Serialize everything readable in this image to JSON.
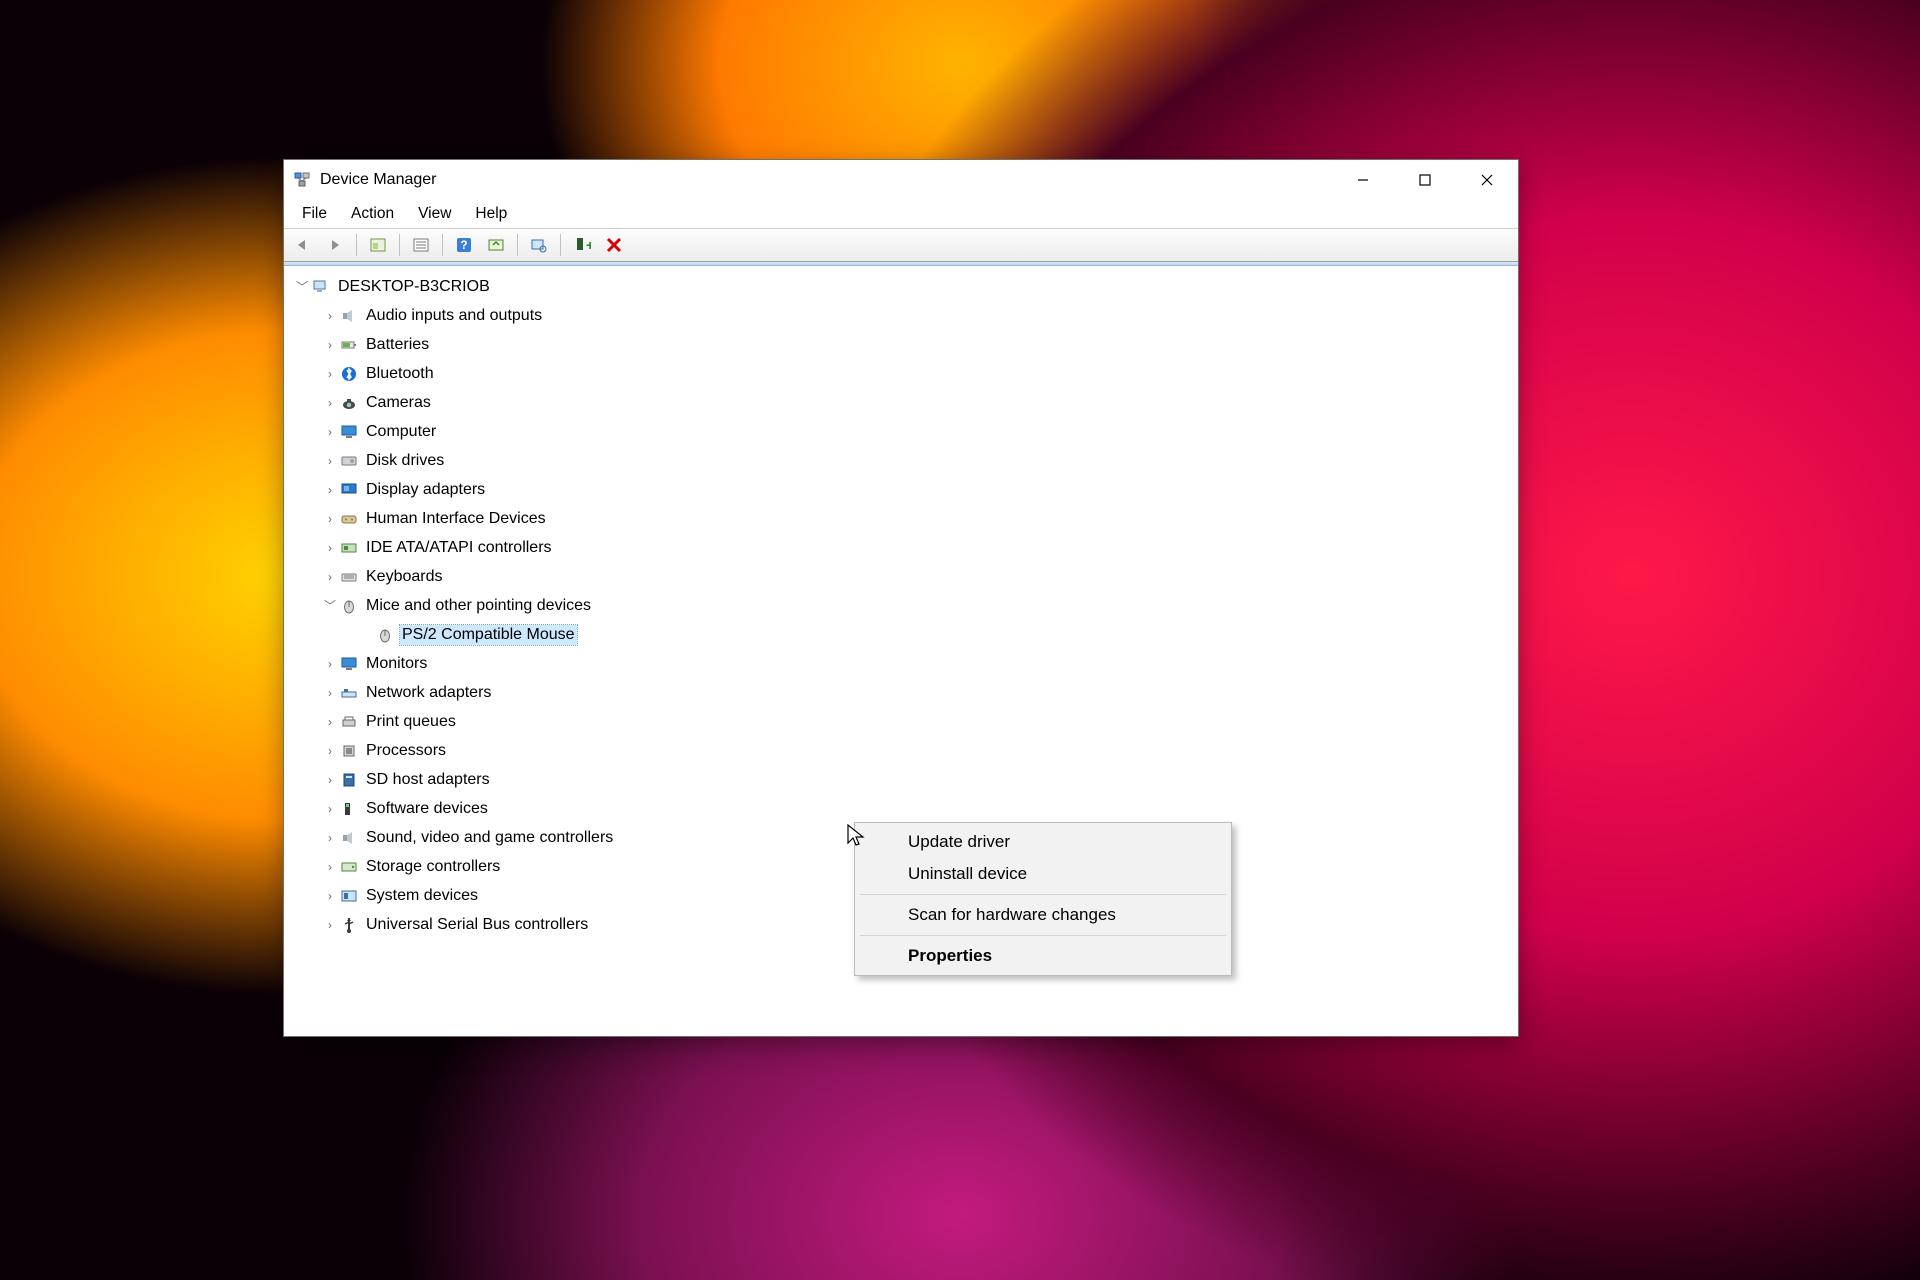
{
  "window": {
    "title": "Device Manager"
  },
  "menu": {
    "file": "File",
    "action": "Action",
    "view": "View",
    "help": "Help"
  },
  "toolbar": {
    "back": "back-icon",
    "forward": "forward-icon",
    "show_hidden": "show-hidden-icon",
    "properties": "properties-icon",
    "help": "help-icon",
    "update": "update-icon",
    "scan": "scan-icon",
    "add": "add-icon",
    "remove": "remove-icon"
  },
  "tree": {
    "root": "DESKTOP-B3CRIOB",
    "categories": [
      {
        "label": "Audio inputs and outputs",
        "icon": "speaker"
      },
      {
        "label": "Batteries",
        "icon": "battery"
      },
      {
        "label": "Bluetooth",
        "icon": "bluetooth"
      },
      {
        "label": "Cameras",
        "icon": "camera"
      },
      {
        "label": "Computer",
        "icon": "monitor"
      },
      {
        "label": "Disk drives",
        "icon": "disk"
      },
      {
        "label": "Display adapters",
        "icon": "display"
      },
      {
        "label": "Human Interface Devices",
        "icon": "hid"
      },
      {
        "label": "IDE ATA/ATAPI controllers",
        "icon": "ide"
      },
      {
        "label": "Keyboards",
        "icon": "keyboard"
      },
      {
        "label": "Mice and other pointing devices",
        "icon": "mouse",
        "expanded": true,
        "children": [
          {
            "label": "PS/2 Compatible Mouse",
            "icon": "mouse",
            "selected": true
          }
        ]
      },
      {
        "label": "Monitors",
        "icon": "monitor"
      },
      {
        "label": "Network adapters",
        "icon": "network"
      },
      {
        "label": "Print queues",
        "icon": "printer"
      },
      {
        "label": "Processors",
        "icon": "cpu"
      },
      {
        "label": "SD host adapters",
        "icon": "sd"
      },
      {
        "label": "Software devices",
        "icon": "software"
      },
      {
        "label": "Sound, video and game controllers",
        "icon": "speaker"
      },
      {
        "label": "Storage controllers",
        "icon": "storage"
      },
      {
        "label": "System devices",
        "icon": "system"
      },
      {
        "label": "Universal Serial Bus controllers",
        "icon": "usb"
      }
    ]
  },
  "context_menu": {
    "items": [
      {
        "label": "Update driver"
      },
      {
        "label": "Uninstall device"
      },
      {
        "sep": true
      },
      {
        "label": "Scan for hardware changes"
      },
      {
        "sep": true
      },
      {
        "label": "Properties",
        "bold": true
      }
    ]
  }
}
